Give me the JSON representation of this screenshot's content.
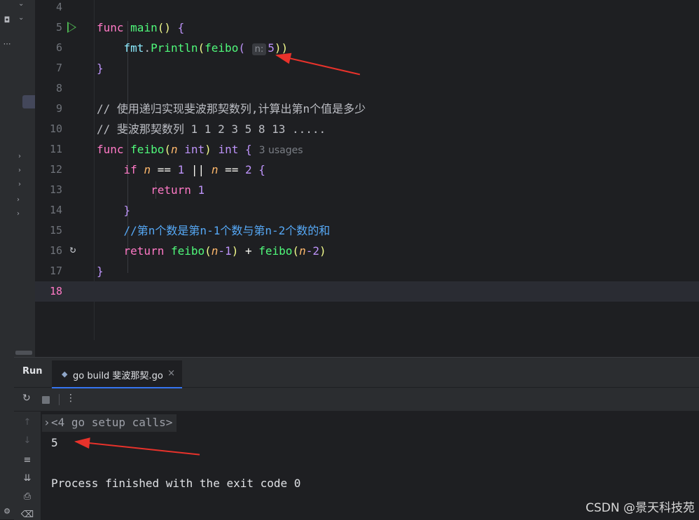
{
  "editor": {
    "lines": [
      {
        "n": "4"
      },
      {
        "n": "5"
      },
      {
        "n": "6"
      },
      {
        "n": "7"
      },
      {
        "n": "8"
      },
      {
        "n": "9"
      },
      {
        "n": "10"
      },
      {
        "n": "11"
      },
      {
        "n": "12"
      },
      {
        "n": "13"
      },
      {
        "n": "14"
      },
      {
        "n": "15"
      },
      {
        "n": "16"
      },
      {
        "n": "17"
      },
      {
        "n": "18"
      }
    ],
    "code": {
      "l5_kw": "func",
      "l5_fn": "main",
      "l5_paren": "()",
      "l5_brace": "{",
      "l6_pkg": "fmt",
      "l6_dot": ".",
      "l6_fn": "Println",
      "l6_open": "(",
      "l6_call": "feibo",
      "l6_open2": "(",
      "l6_hint": "n:",
      "l6_arg": "5",
      "l6_close": "))",
      "l7_brace": "}",
      "l9_comment": "// 使用递归实现斐波那契数列,计算出第n个值是多少",
      "l10_comment": "// 斐波那契数列 1 1 2 3 5 8 13 .....",
      "l11_kw": "func",
      "l11_fn": "feibo",
      "l11_open": "(",
      "l11_param": "n",
      "l11_type": "int",
      "l11_close": ")",
      "l11_ret": "int",
      "l11_brace": "{",
      "l11_usages": "3 usages",
      "l12_kw": "if",
      "l12_p1": "n",
      "l12_op1": "==",
      "l12_v1": "1",
      "l12_or": "||",
      "l12_p2": "n",
      "l12_op2": "==",
      "l12_v2": "2",
      "l12_brace": "{",
      "l13_kw": "return",
      "l13_v": "1",
      "l14_brace": "}",
      "l15_comment": "//第n个数是第n-1个数与第n-2个数的和",
      "l16_kw": "return",
      "l16_f1": "feibo",
      "l16_o1": "(",
      "l16_p1": "n",
      "l16_m1": "-1",
      "l16_c1": ")",
      "l16_plus": "+",
      "l16_f2": "feibo",
      "l16_o2": "(",
      "l16_p2": "n",
      "l16_m2": "-2",
      "l16_c2": ")",
      "l17_brace": "}"
    }
  },
  "run_panel": {
    "title": "Run",
    "tab_label": "go build 斐波那契.go",
    "tab_close": "×",
    "console": {
      "group": "<4 go setup calls>",
      "output": "5",
      "exit_message": "Process finished with the exit code 0"
    }
  },
  "icons": {
    "run_gutter": "run-triangle-icon",
    "recursive_call": "recursive-call-icon",
    "rerun": "rerun-icon",
    "stop": "stop-icon",
    "more": "more-vertical-icon"
  },
  "watermark": "CSDN @景天科技苑",
  "colors": {
    "background": "#1e1f22",
    "panel": "#2b2d30",
    "keyword": "#ff79c6",
    "function": "#50fa7b",
    "comment": "#56a8f5",
    "annotation_arrow": "#e8322b",
    "tab_underline": "#3574f0"
  }
}
